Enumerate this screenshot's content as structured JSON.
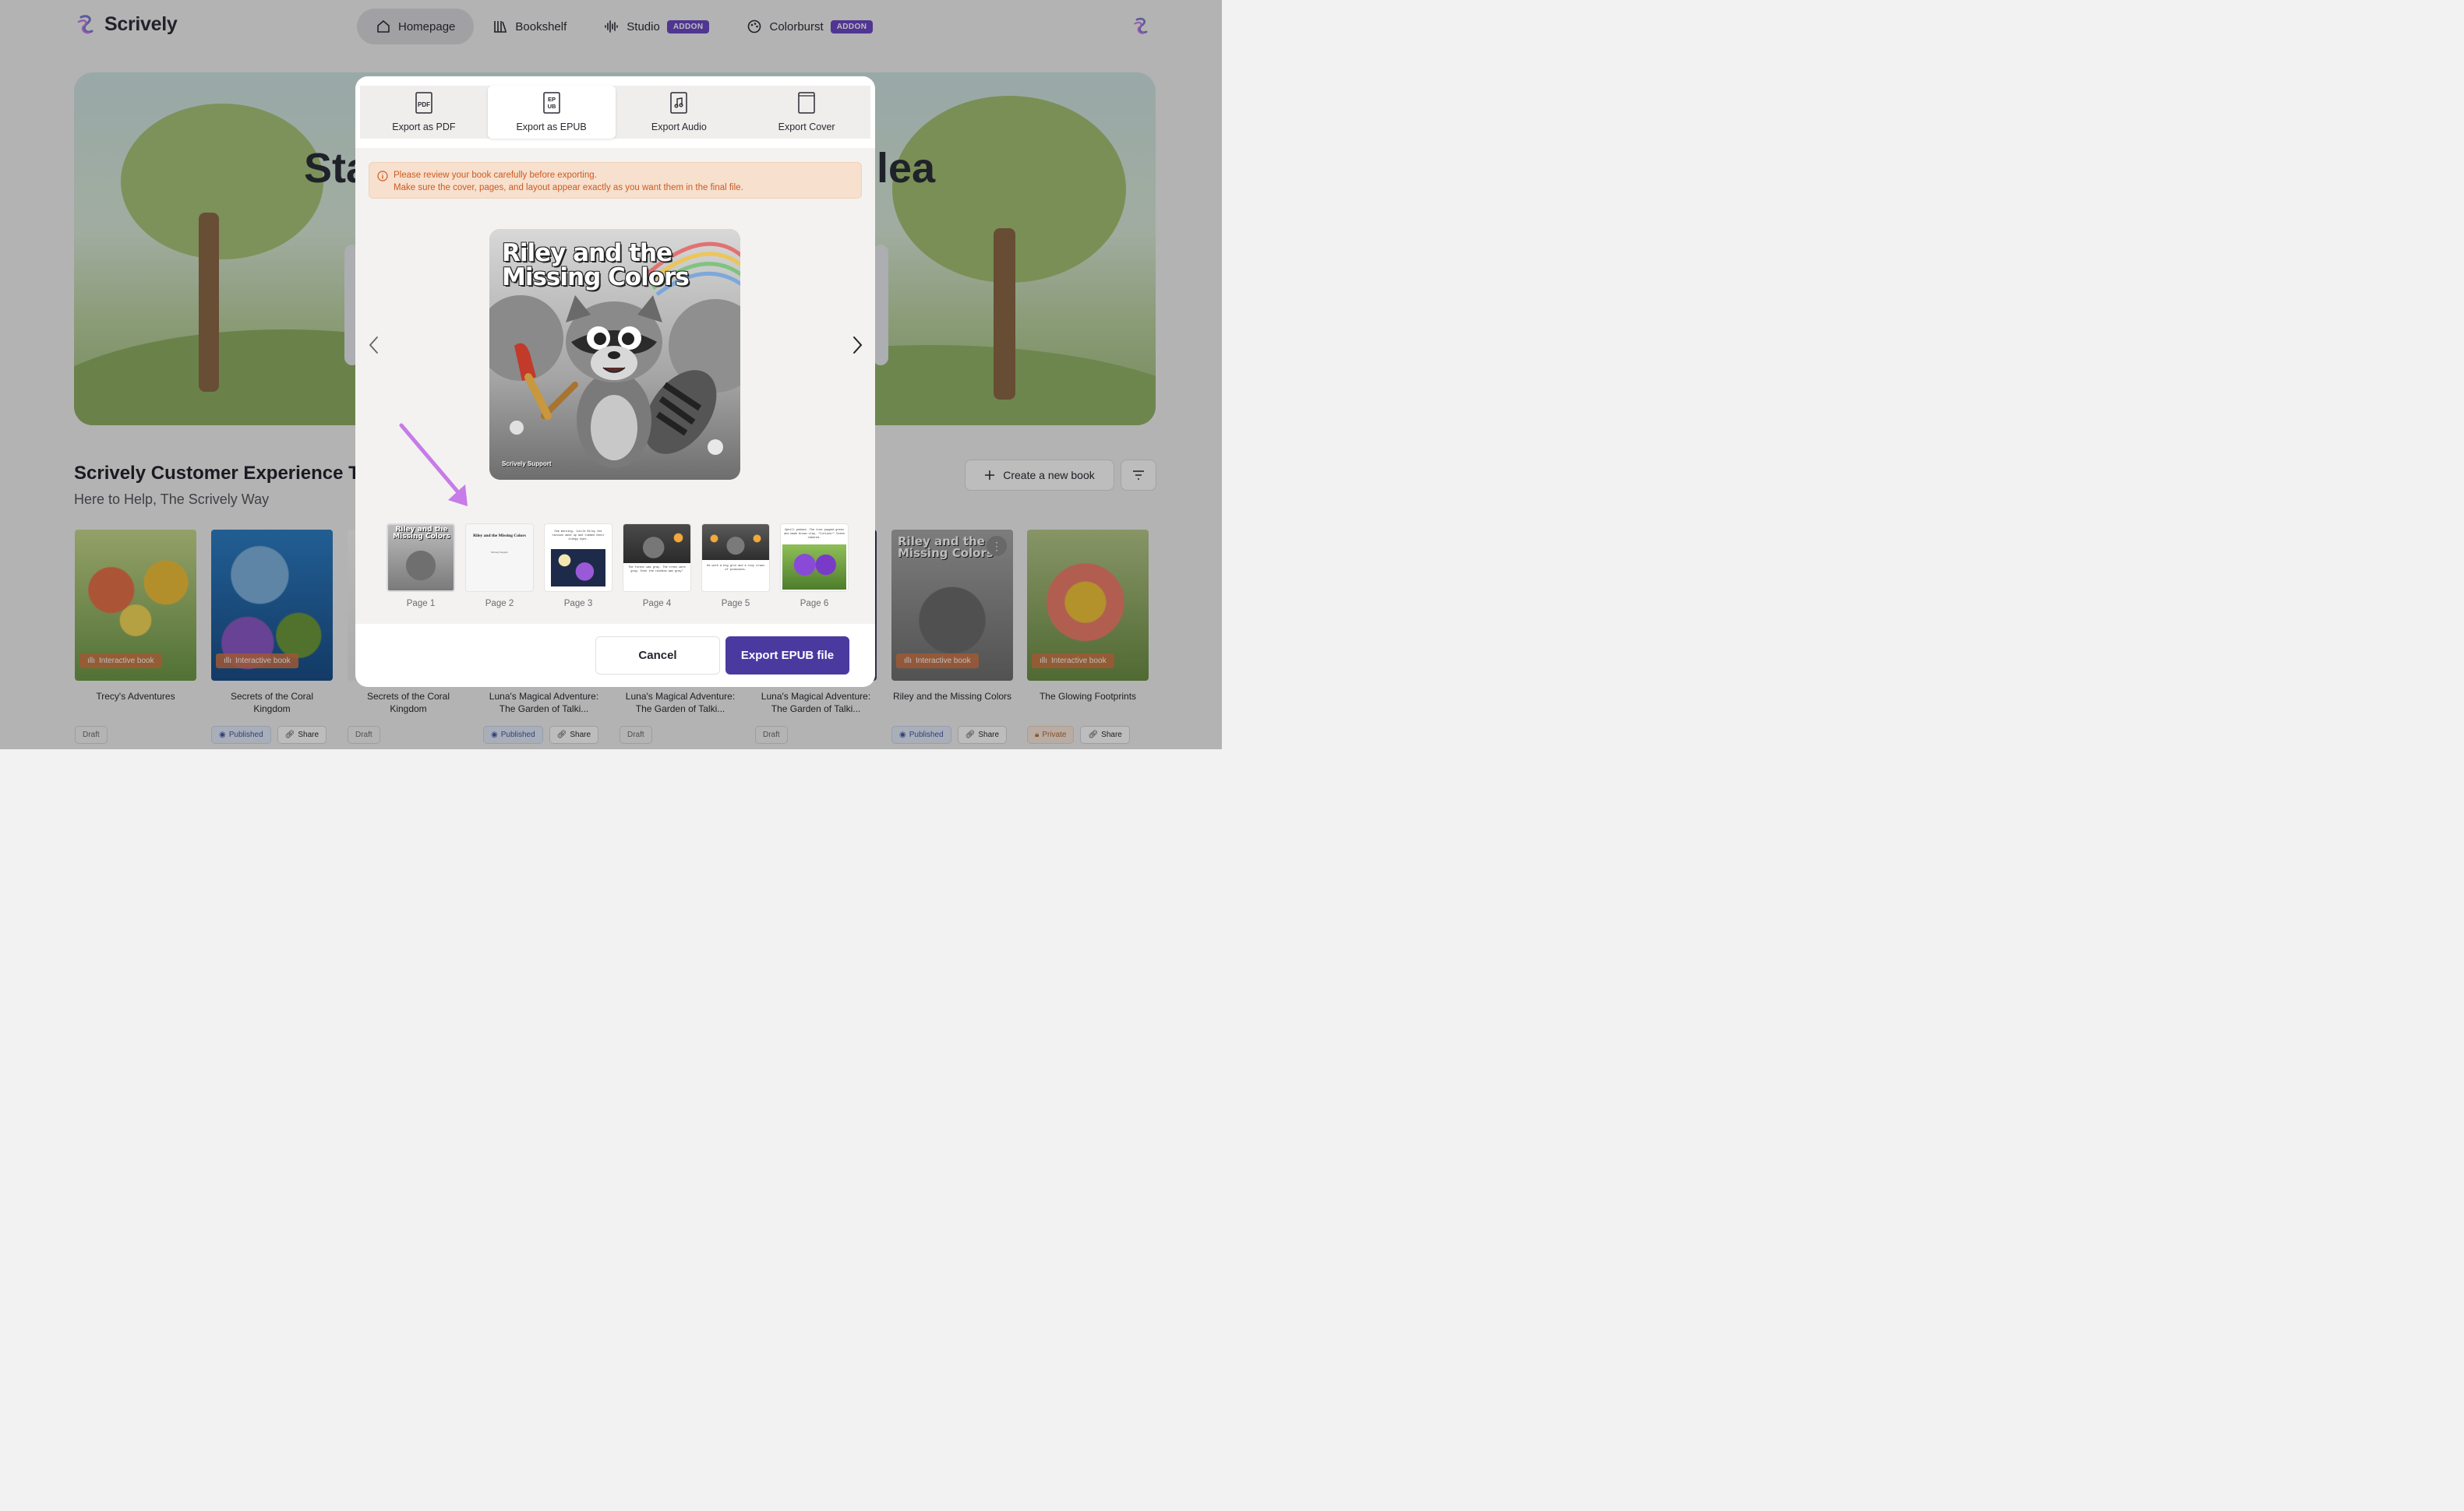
{
  "app": {
    "name": "Scrively"
  },
  "nav": {
    "items": [
      {
        "label": "Homepage",
        "active": true,
        "icon": "home-icon"
      },
      {
        "label": "Bookshelf",
        "icon": "bookshelf-icon"
      },
      {
        "label": "Studio",
        "badge": "ADDON",
        "icon": "audio-wave-icon"
      },
      {
        "label": "Colorburst",
        "badge": "ADDON",
        "icon": "palette-icon"
      }
    ]
  },
  "hero": {
    "text_left": "Sta",
    "text_right": "lea"
  },
  "section": {
    "title": "Scrively Customer Experience Te",
    "subtitle": "Here to Help, The Scrively Way",
    "create_label": "Create a new book"
  },
  "books": [
    {
      "title": "Trecy's Adventures",
      "chip": "Interactive book",
      "status": "Draft"
    },
    {
      "title": "Secrets of the Coral Kingdom",
      "chip": "Interactive book",
      "status": "Published",
      "share": "Share"
    },
    {
      "title": "Secrets of the Coral Kingdom",
      "status": "Draft"
    },
    {
      "title": "Luna's Magical Adventure: The Garden of Talki...",
      "status": "Published",
      "share": "Share"
    },
    {
      "title": "Luna's Magical Adventure: The Garden of Talki...",
      "status": "Draft"
    },
    {
      "title": "Luna's Magical Adventure: The Garden of Talki...",
      "status": "Draft"
    },
    {
      "title": "Riley and the Missing Colors",
      "chip": "Interactive book",
      "status": "Published",
      "share": "Share"
    },
    {
      "title": "The Glowing Footprints",
      "chip": "Interactive book",
      "status": "Private",
      "share": "Share"
    }
  ],
  "modal": {
    "tabs": [
      {
        "label": "Export as PDF",
        "icon": "pdf-file-icon"
      },
      {
        "label": "Export as EPUB",
        "icon": "epub-file-icon",
        "active": true
      },
      {
        "label": "Export Audio",
        "icon": "audio-file-icon"
      },
      {
        "label": "Export Cover",
        "icon": "cover-file-icon"
      }
    ],
    "alert": {
      "line1": "Please review your book carefully before exporting.",
      "line2": "Make sure the cover, pages, and layout appear exactly as you want them in the final file."
    },
    "preview": {
      "title": "Riley and the Missing Colors",
      "author": "Scrively Support"
    },
    "pages": [
      {
        "label": "Page 1"
      },
      {
        "label": "Page 2",
        "title": "Riley and the Missing Colors",
        "author": "Scrively Support"
      },
      {
        "label": "Page 3",
        "text": "One morning, little Riley the raccoon woke up and rubbed their sleepy eyes."
      },
      {
        "label": "Page 4",
        "text": "The forest was gray. The trees were gray. Even the rainbow was gray!"
      },
      {
        "label": "Page 5",
        "text": "He wore a big grin and a tiny crown of pinecones."
      },
      {
        "label": "Page 6",
        "text": "Uphill peeked. The tree popped green and made brown clay. \"Curious!\" Green cheered."
      }
    ],
    "cancel_label": "Cancel",
    "export_label": "Export EPUB file"
  },
  "colors": {
    "accent": "#4a3aa0",
    "badge": "#6c48c5",
    "alert_text": "#cc5a24",
    "alert_bg": "#f7e0cd",
    "annotation": "#c77be8"
  }
}
